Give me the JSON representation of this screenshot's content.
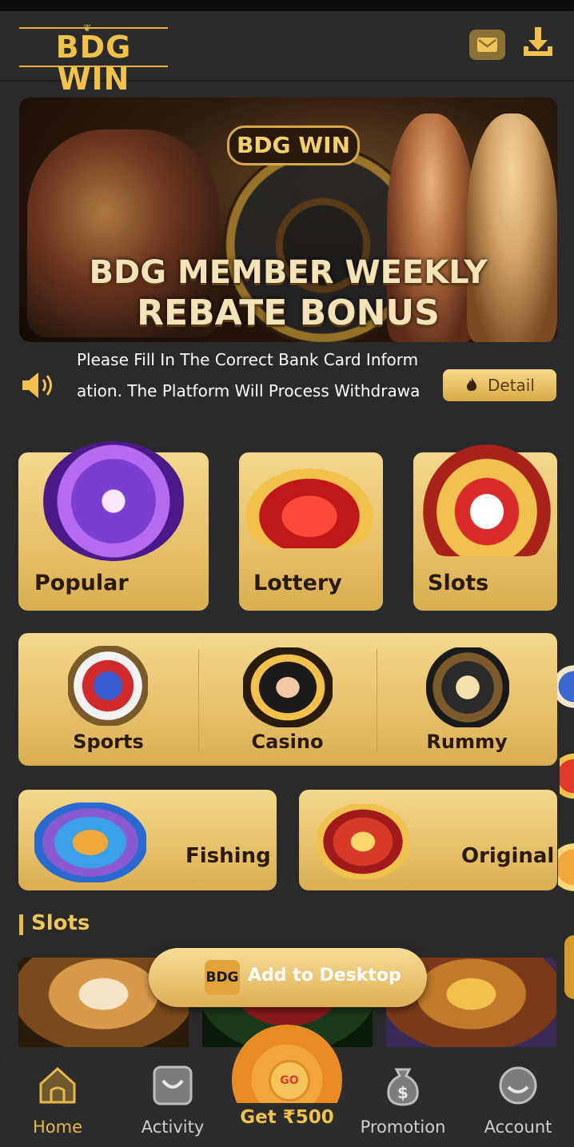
{
  "header": {
    "logo_text": "BDG WIN",
    "mail_icon": "mail-icon",
    "download_icon": "download-icon"
  },
  "banner": {
    "logo_text": "BDG WIN",
    "line1": "BDG MEMBER WEEKLY",
    "line2": "REBATE BONUS"
  },
  "notice": {
    "line1": "Please Fill In The Correct Bank Card Inform",
    "line2": "ation. The Platform Will Process Withdrawa",
    "detail_label": "Detail"
  },
  "categories": {
    "top": [
      {
        "label": "Popular"
      },
      {
        "label": "Lottery"
      },
      {
        "label": "Slots"
      }
    ],
    "middle": [
      {
        "label": "Sports"
      },
      {
        "label": "Casino"
      },
      {
        "label": "Rummy"
      }
    ],
    "bottom": [
      {
        "label": "Fishing"
      },
      {
        "label": "Original"
      }
    ]
  },
  "section": {
    "title": "Slots"
  },
  "add_to_desktop": {
    "icon_text": "BDG",
    "label": "Add to Desktop"
  },
  "wheel": {
    "go_label": "GO",
    "label": "Get ₹500"
  },
  "nav": {
    "items": [
      {
        "label": "Home",
        "icon": "home-icon"
      },
      {
        "label": "Activity",
        "icon": "activity-icon"
      },
      {
        "label": "Promotion",
        "icon": "promotion-icon"
      },
      {
        "label": "Account",
        "icon": "account-icon"
      }
    ]
  },
  "colors": {
    "accent": "#e8b84b",
    "background": "#2a2a2a",
    "card_gold": "#e6c069"
  }
}
